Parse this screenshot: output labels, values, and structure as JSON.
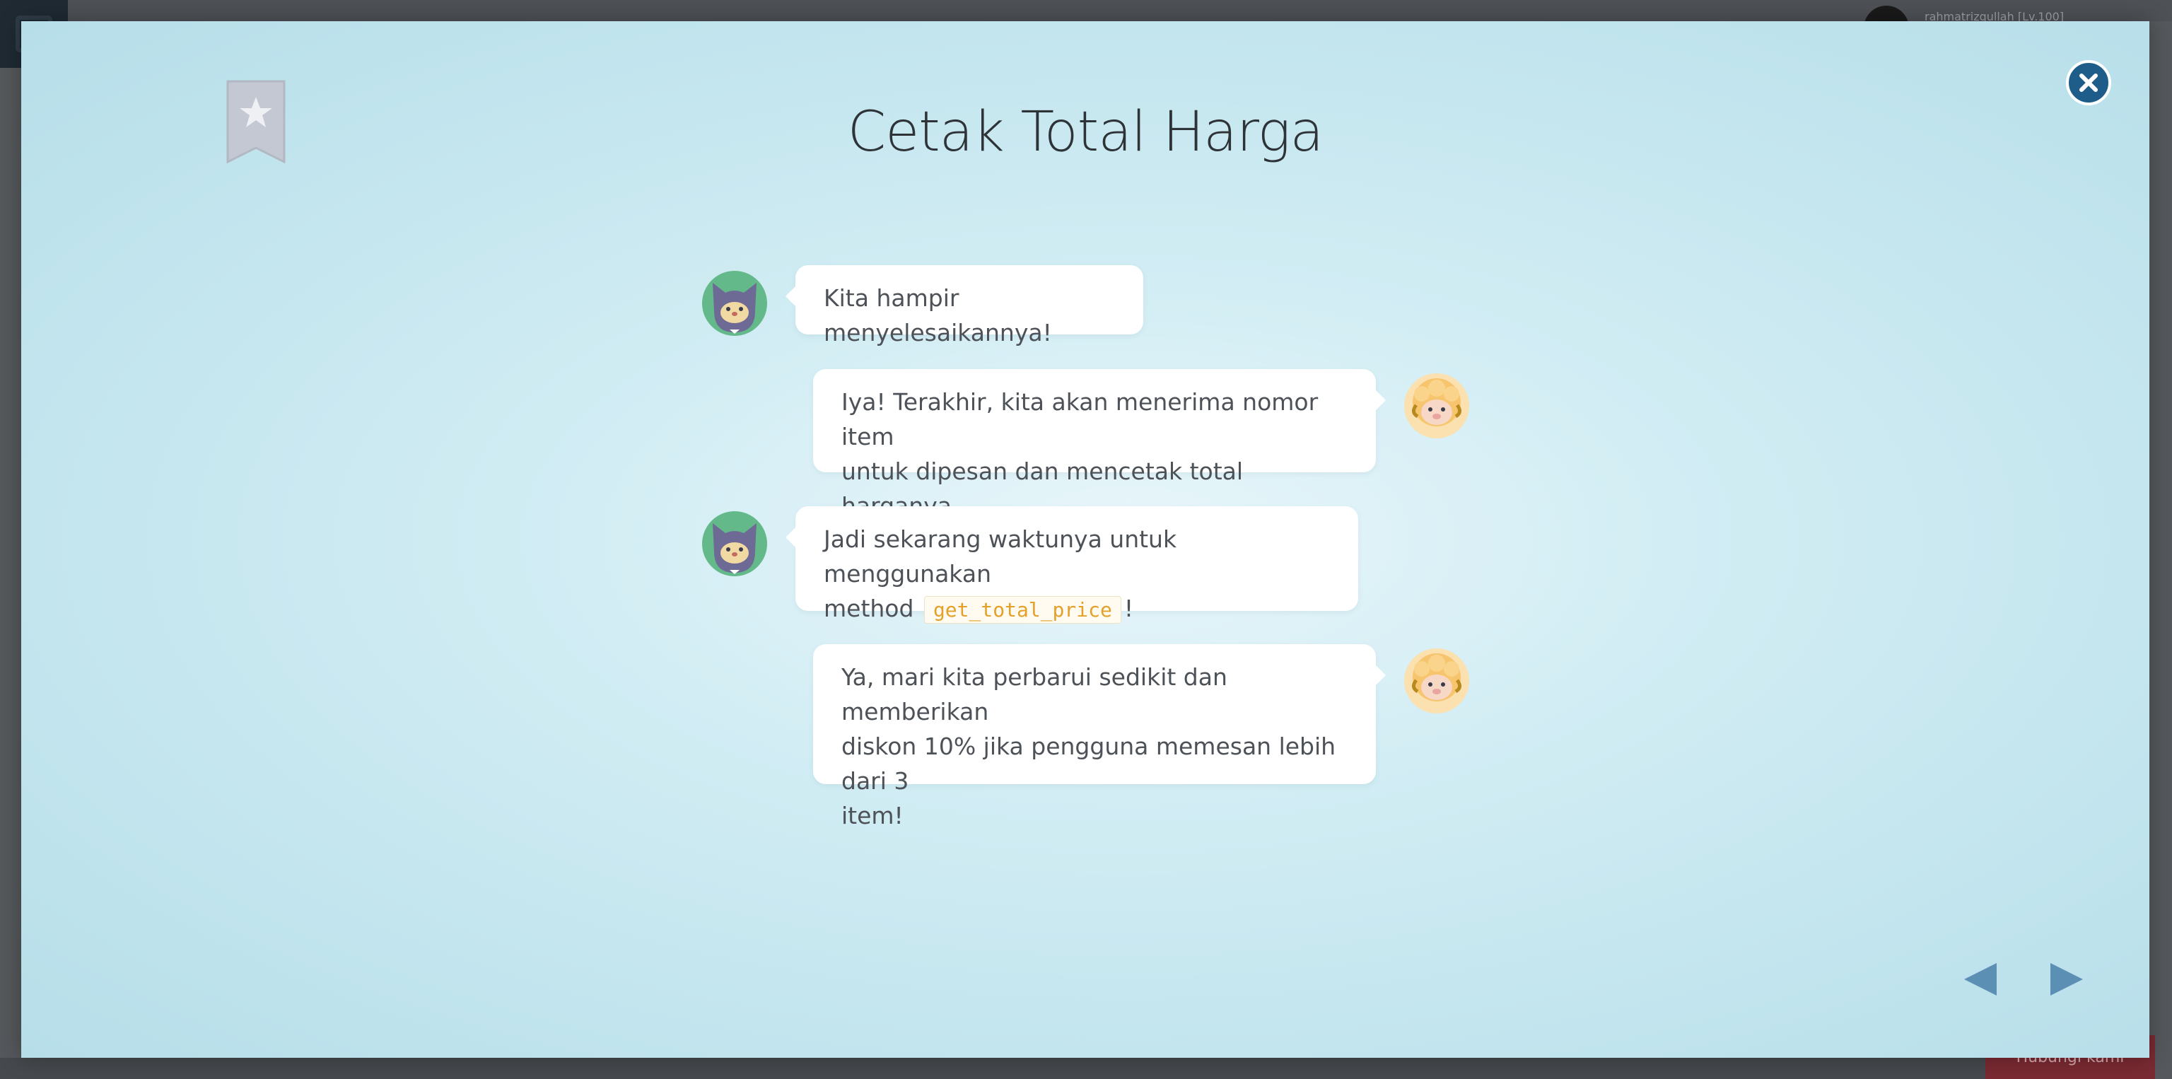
{
  "background": {
    "username": "rahmatrizqullah [Lv.100]",
    "bottom_button_label": "Hubungi kami"
  },
  "modal": {
    "title": "Cetak Total Harga",
    "messages": [
      {
        "speaker": "cat",
        "text": "Kita hampir menyelesaikannya!"
      },
      {
        "speaker": "sheep",
        "lines": [
          "Iya! Terakhir, kita akan menerima nomor item",
          "untuk dipesan dan mencetak total harganya."
        ]
      },
      {
        "speaker": "cat",
        "line1": "Jadi sekarang waktunya untuk menggunakan",
        "line2_prefix": "method",
        "code": "get_total_price",
        "line2_suffix": "!"
      },
      {
        "speaker": "sheep",
        "lines": [
          "Ya, mari kita perbarui sedikit dan memberikan",
          "diskon 10% jika pengguna memesan lebih dari 3",
          "item!"
        ]
      }
    ]
  },
  "colors": {
    "close_button": "#1e5d89",
    "nav_arrow": "#5b8fb3",
    "code_text": "#e5a02a",
    "bookmark": "#c3c8d2"
  },
  "icons": {
    "bookmark": "star-bookmark-icon",
    "close": "close-icon",
    "prev": "triangle-left-icon",
    "next": "triangle-right-icon",
    "cat_avatar": "cat-avatar-icon",
    "sheep_avatar": "sheep-avatar-icon"
  }
}
